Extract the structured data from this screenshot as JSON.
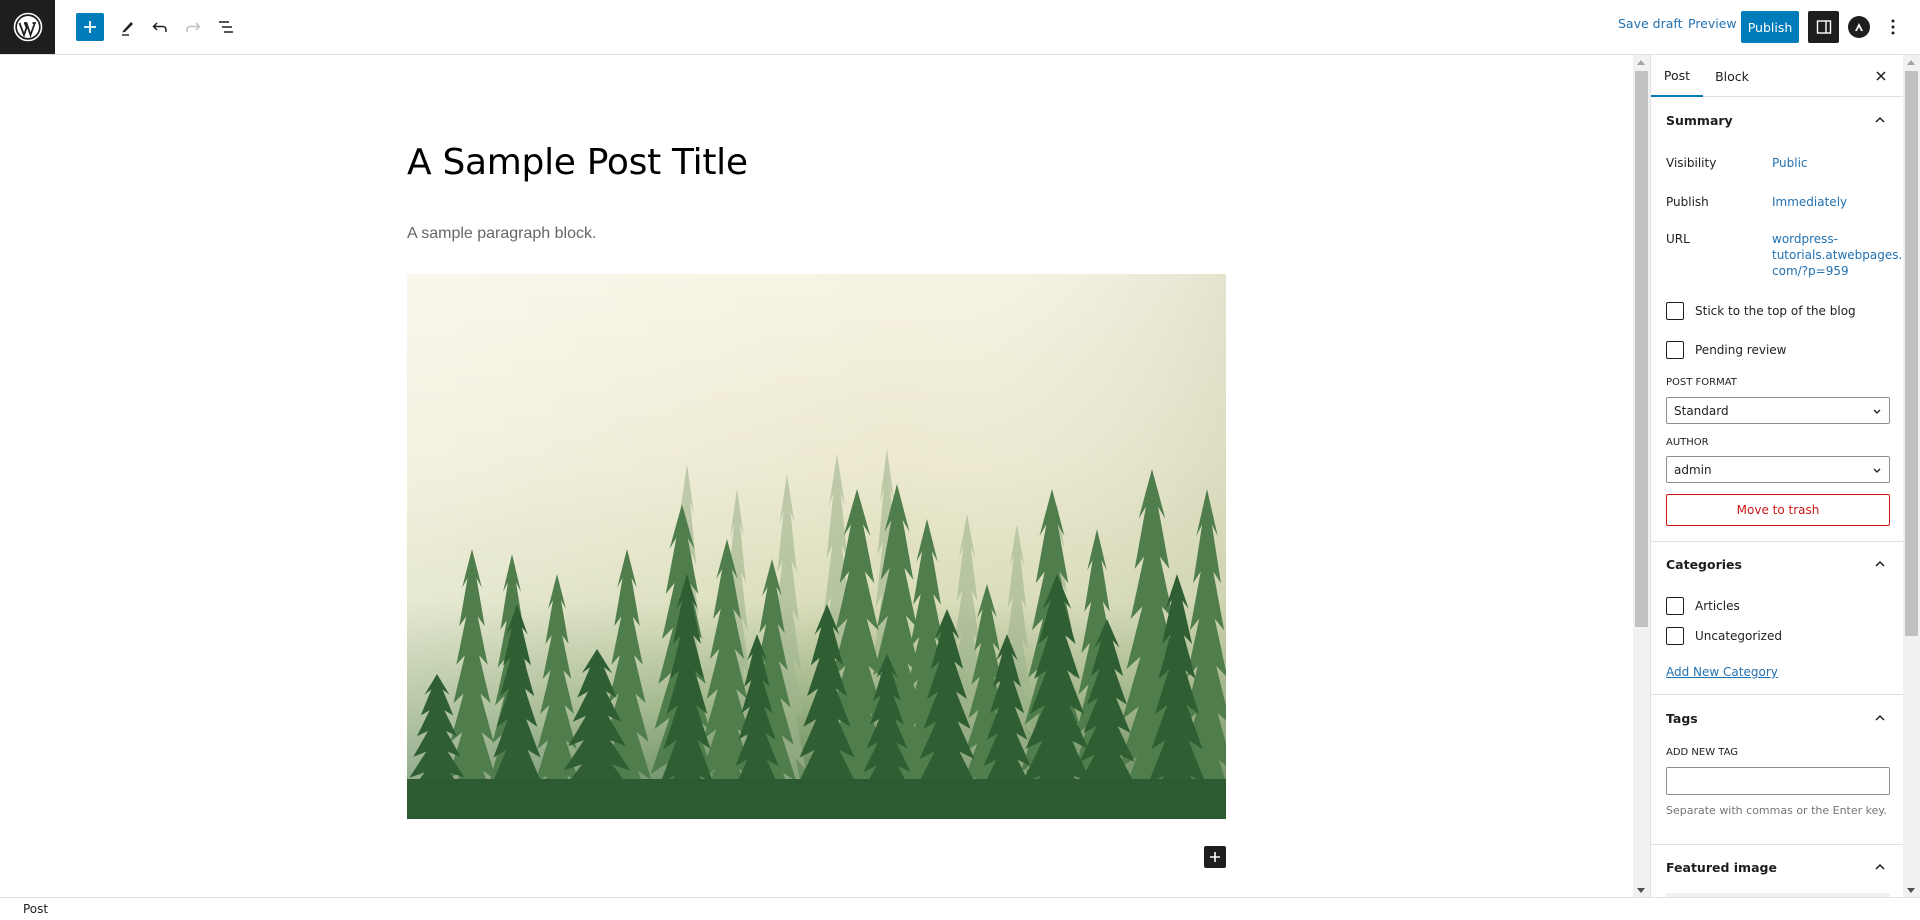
{
  "header": {
    "logo": "wordpress-logo",
    "toolbar": {
      "inserter_icon": "plus-icon",
      "tools_icon": "pencil-icon",
      "undo_icon": "undo-icon",
      "redo_icon": "redo-icon",
      "list_view_icon": "list-view-icon"
    },
    "save_draft_label": "Save draft",
    "preview_label": "Preview",
    "publish_label": "Publish",
    "settings_icon": "sidebar-toggle-icon",
    "astra_icon": "astra-icon",
    "options_icon": "more-vertical-icon"
  },
  "editor": {
    "title": "A Sample Post Title",
    "paragraph": "A sample paragraph block.",
    "image": "foggy-pine-forest"
  },
  "sidebar": {
    "tabs": [
      {
        "label": "Post",
        "active": true
      },
      {
        "label": "Block",
        "active": false
      }
    ],
    "summary": {
      "title": "Summary",
      "visibility_label": "Visibility",
      "visibility_value": "Public",
      "publish_label": "Publish",
      "publish_value": "Immediately",
      "url_label": "URL",
      "url_lines": [
        "wordpress-",
        "tutorials.atwebpages.",
        "com/?p=959"
      ],
      "stick_label": "Stick to the top of the blog",
      "pending_label": "Pending review",
      "post_format_label": "POST FORMAT",
      "post_format_value": "Standard",
      "author_label": "AUTHOR",
      "author_value": "admin",
      "trash_label": "Move to trash"
    },
    "categories": {
      "title": "Categories",
      "items": [
        {
          "label": "Articles",
          "checked": false
        },
        {
          "label": "Uncategorized",
          "checked": false
        }
      ],
      "add_new_label": "Add New Category"
    },
    "tags": {
      "title": "Tags",
      "add_label": "ADD NEW TAG",
      "input_value": "",
      "help": "Separate with commas or the Enter key."
    },
    "featured_image": {
      "title": "Featured image"
    }
  },
  "footer": {
    "breadcrumb": "Post"
  },
  "colors": {
    "accent": "#007cba",
    "link": "#2271b1",
    "danger": "#cc1818",
    "dark": "#1e1e1e"
  }
}
